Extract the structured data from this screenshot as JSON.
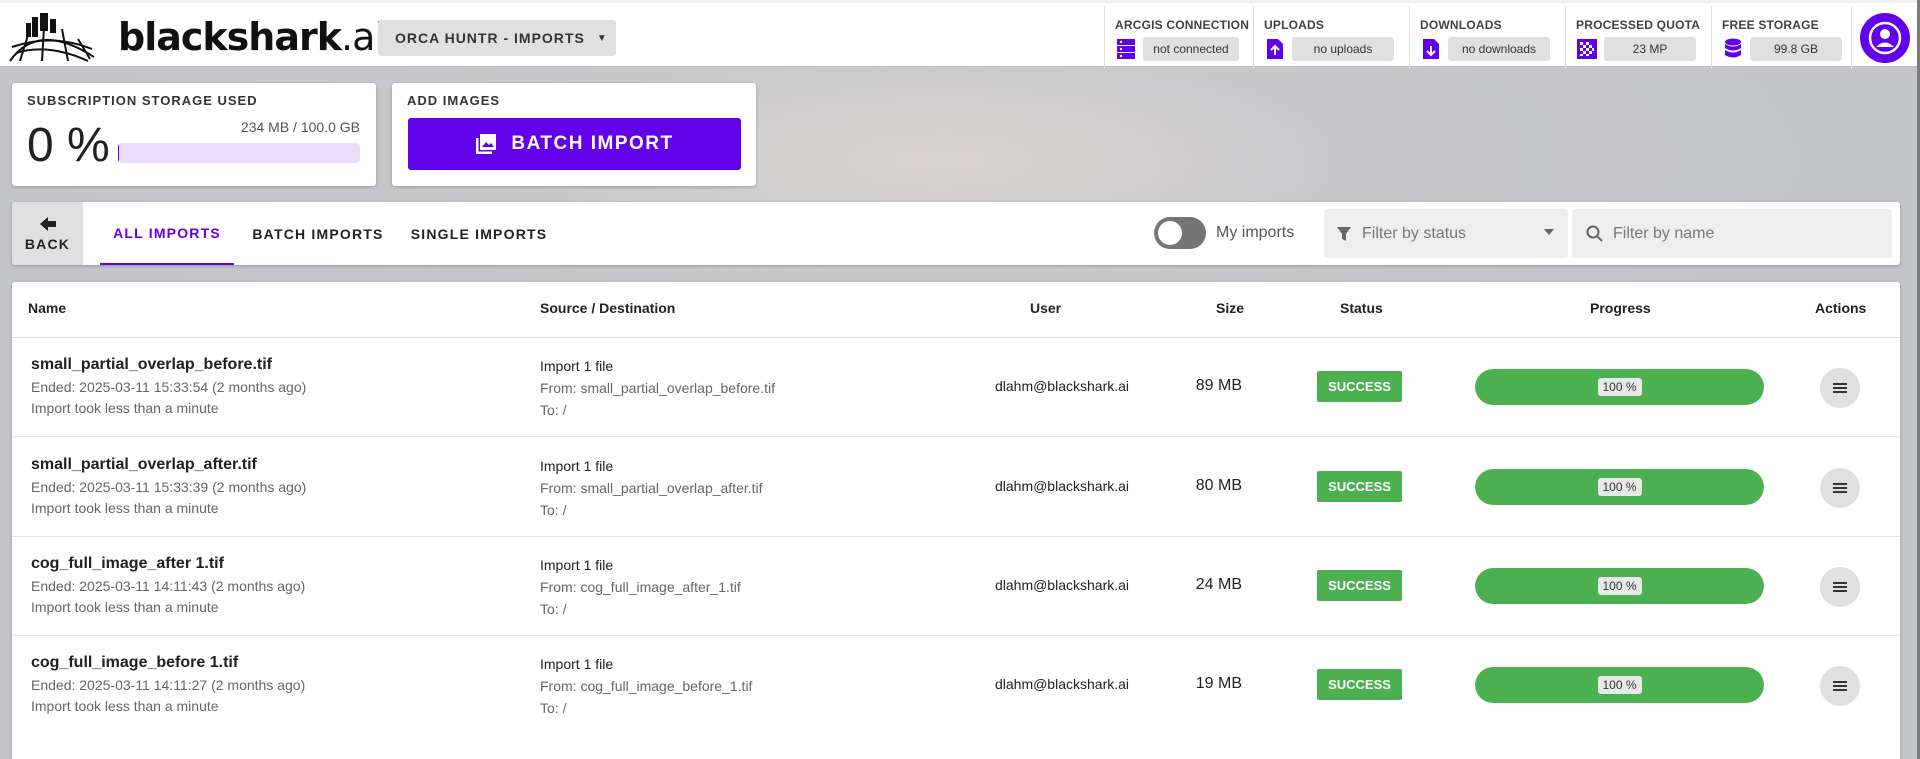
{
  "brand": {
    "name": "blackshark",
    "suffix": ".ai"
  },
  "project_selector": {
    "label": "ORCA HUNTR - IMPORTS"
  },
  "stats": {
    "arcgis": {
      "label": "ARCGIS CONNECTION",
      "value": "not connected"
    },
    "uploads": {
      "label": "UPLOADS",
      "value": "no uploads"
    },
    "downloads": {
      "label": "DOWNLOADS",
      "value": "no downloads"
    },
    "quota": {
      "label": "PROCESSED QUOTA",
      "value": "23 MP"
    },
    "free_storage": {
      "label": "FREE STORAGE",
      "value": "99.8 GB"
    }
  },
  "storage_card": {
    "title": "SUBSCRIPTION STORAGE USED",
    "percent": "0 %",
    "size": "234 MB / 100.0 GB",
    "used_fraction": 0.0023
  },
  "add_card": {
    "title": "ADD IMAGES",
    "button": "BATCH IMPORT"
  },
  "toolbar": {
    "back": "BACK",
    "tabs": [
      "ALL IMPORTS",
      "BATCH IMPORTS",
      "SINGLE IMPORTS"
    ],
    "active_tab": "ALL IMPORTS",
    "toggle_label": "My imports",
    "status_placeholder": "Filter by status",
    "name_placeholder": "Filter by name"
  },
  "table": {
    "headers": {
      "name": "Name",
      "source": "Source / Destination",
      "user": "User",
      "size": "Size",
      "status": "Status",
      "progress": "Progress",
      "actions": "Actions"
    },
    "rows": [
      {
        "name": "small_partial_overlap_before.tif",
        "ended": "Ended: 2025-03-11 15:33:54 (2 months ago)",
        "duration": "Import took less than a minute",
        "src_title": "Import 1 file",
        "from": "From: small_partial_overlap_before.tif",
        "to": "To: /",
        "user": "dlahm@blackshark.ai",
        "size": "89 MB",
        "status": "SUCCESS",
        "progress_label": "100 %",
        "progress": 100
      },
      {
        "name": "small_partial_overlap_after.tif",
        "ended": "Ended: 2025-03-11 15:33:39 (2 months ago)",
        "duration": "Import took less than a minute",
        "src_title": "Import 1 file",
        "from": "From: small_partial_overlap_after.tif",
        "to": "To: /",
        "user": "dlahm@blackshark.ai",
        "size": "80 MB",
        "status": "SUCCESS",
        "progress_label": "100 %",
        "progress": 100
      },
      {
        "name": "cog_full_image_after 1.tif",
        "ended": "Ended: 2025-03-11 14:11:43 (2 months ago)",
        "duration": "Import took less than a minute",
        "src_title": "Import 1 file",
        "from": "From: cog_full_image_after_1.tif",
        "to": "To: /",
        "user": "dlahm@blackshark.ai",
        "size": "24 MB",
        "status": "SUCCESS",
        "progress_label": "100 %",
        "progress": 100
      },
      {
        "name": "cog_full_image_before 1.tif",
        "ended": "Ended: 2025-03-11 14:11:27 (2 months ago)",
        "duration": "Import took less than a minute",
        "src_title": "Import 1 file",
        "from": "From: cog_full_image_before_1.tif",
        "to": "To: /",
        "user": "dlahm@blackshark.ai",
        "size": "19 MB",
        "status": "SUCCESS",
        "progress_label": "100 %",
        "progress": 100
      }
    ]
  },
  "colors": {
    "accent": "#6200ea",
    "success": "#4caf50"
  },
  "icons": [
    "blackshark-globe-logo",
    "server-icon",
    "upload-file-icon",
    "download-file-icon",
    "quota-grid-icon",
    "database-icon",
    "account-icon",
    "image-icon",
    "arrow-left-icon",
    "filter-icon",
    "search-icon",
    "menu-icon"
  ]
}
